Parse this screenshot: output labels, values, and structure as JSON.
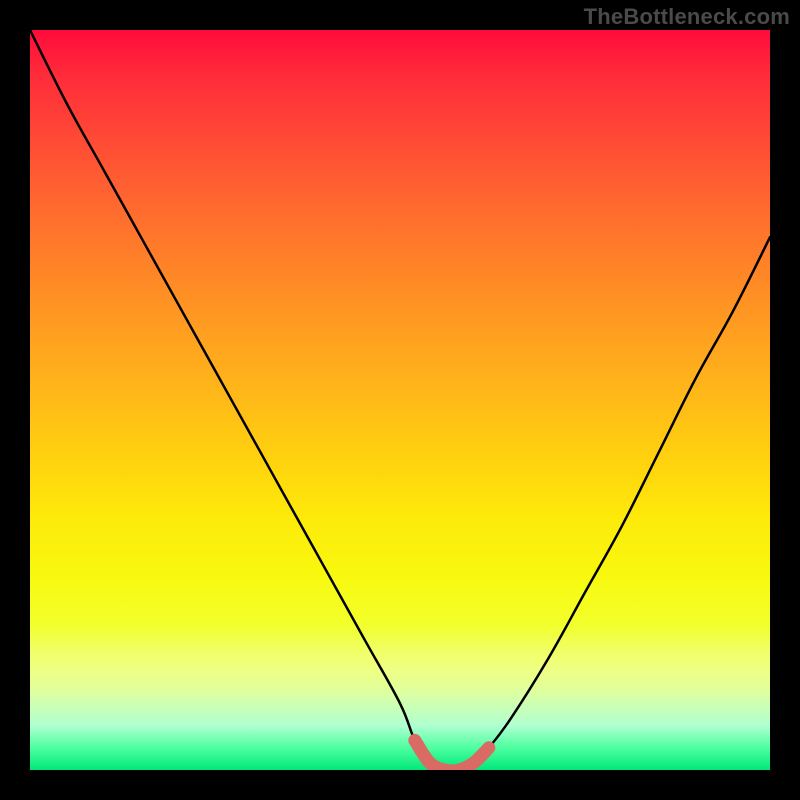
{
  "watermark": {
    "text": "TheBottleneck.com"
  },
  "chart_data": {
    "type": "line",
    "title": "",
    "xlabel": "",
    "ylabel": "",
    "xlim": [
      0,
      100
    ],
    "ylim": [
      0,
      100
    ],
    "grid": false,
    "legend": false,
    "series": [
      {
        "name": "bottleneck-curve",
        "color": "#000000",
        "x": [
          0,
          5,
          10,
          15,
          20,
          25,
          30,
          35,
          40,
          45,
          50,
          52,
          54,
          56,
          58,
          60,
          62,
          65,
          70,
          75,
          80,
          85,
          90,
          95,
          100
        ],
        "y": [
          100,
          90,
          81,
          72,
          63,
          54,
          45,
          36,
          27,
          18,
          9,
          4,
          1,
          0,
          0,
          1,
          3,
          7,
          15,
          24,
          33,
          43,
          53,
          62,
          72
        ]
      },
      {
        "name": "flat-bottom-highlight",
        "color": "#da6a64",
        "style": "thick",
        "x": [
          52,
          54,
          56,
          58,
          60,
          62
        ],
        "y": [
          4,
          1,
          0,
          0,
          1,
          3
        ]
      }
    ],
    "background_gradient": {
      "direction": "vertical",
      "stops": [
        {
          "pos": 0.0,
          "color": "#ff0b3a"
        },
        {
          "pos": 0.5,
          "color": "#ffb41a"
        },
        {
          "pos": 0.8,
          "color": "#f3ff2a"
        },
        {
          "pos": 1.0,
          "color": "#00e87a"
        }
      ]
    }
  }
}
